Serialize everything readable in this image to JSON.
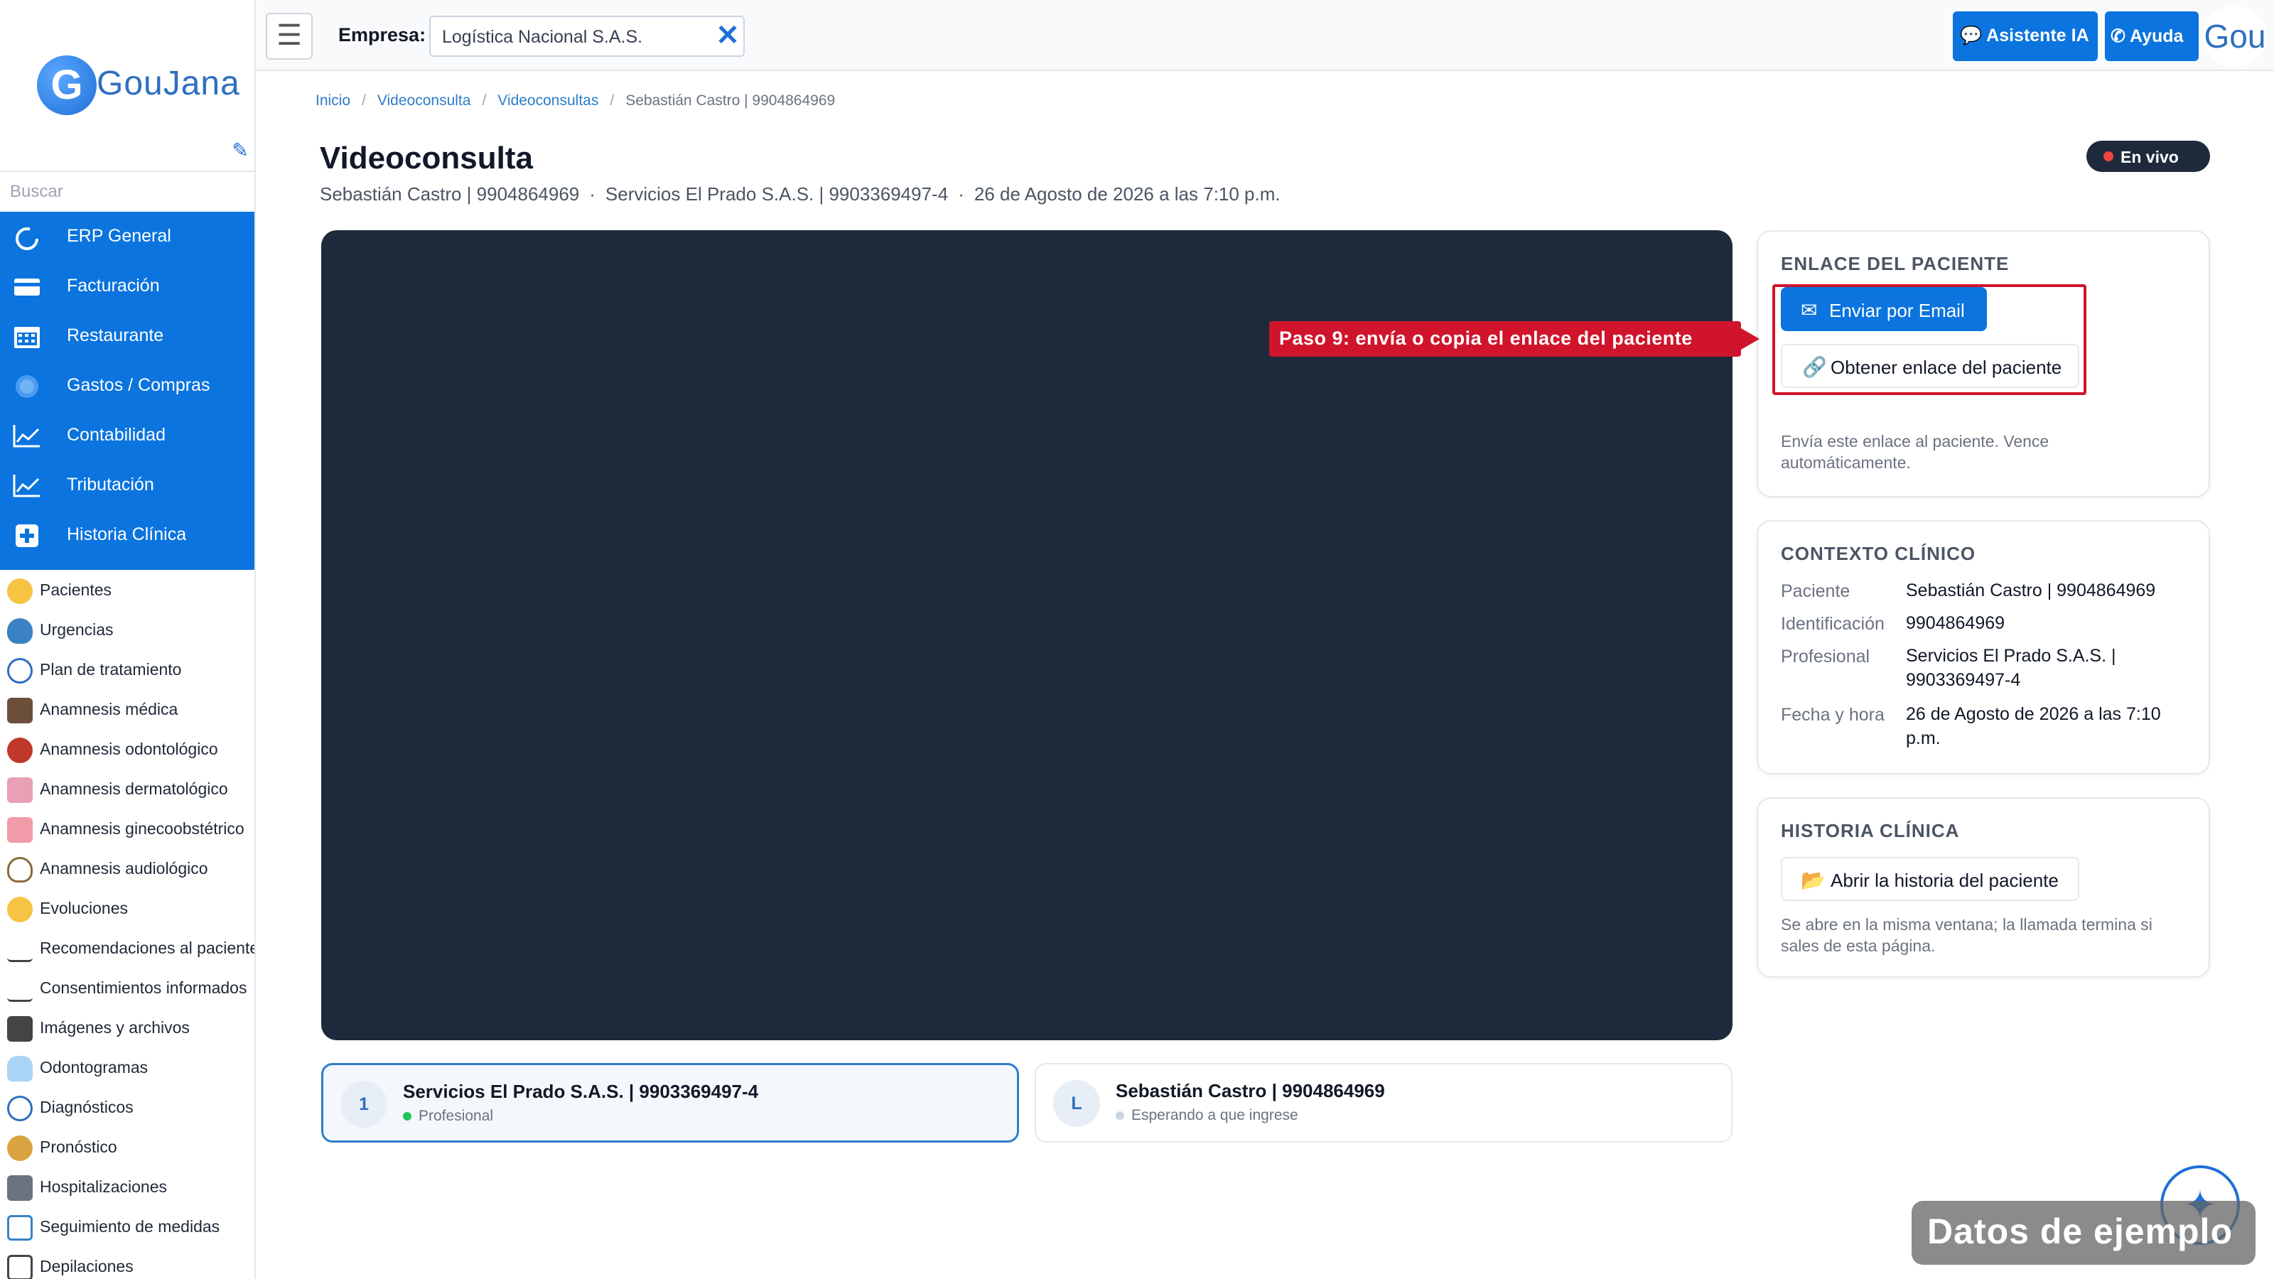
{
  "brand": {
    "logo_letter": "G",
    "name": "GouJana"
  },
  "sidebar": {
    "search_placeholder": "Buscar",
    "modules": [
      {
        "label": "ERP General",
        "icon": "circle-refresh-icon"
      },
      {
        "label": "Facturación",
        "icon": "credit-card-icon"
      },
      {
        "label": "Restaurante",
        "icon": "calendar-icon"
      },
      {
        "label": "Gastos / Compras",
        "icon": "blur-circle-icon"
      },
      {
        "label": "Contabilidad",
        "icon": "line-chart-icon"
      },
      {
        "label": "Tributación",
        "icon": "line-chart-icon"
      },
      {
        "label": "Historia Clínica",
        "icon": "plus-square-icon"
      }
    ],
    "subitems": [
      {
        "label": "Pacientes",
        "icon": "smiley-face-icon"
      },
      {
        "label": "Urgencias",
        "icon": "shield-icon"
      },
      {
        "label": "Plan de tratamiento",
        "icon": "compass-icon"
      },
      {
        "label": "Anamnesis médica",
        "icon": "doctor-icon"
      },
      {
        "label": "Anamnesis odontológico",
        "icon": "mouth-icon"
      },
      {
        "label": "Anamnesis dermatológico",
        "icon": "skin-icon"
      },
      {
        "label": "Anamnesis ginecoobstétrico",
        "icon": "uterus-icon"
      },
      {
        "label": "Anamnesis audiológico",
        "icon": "ear-icon"
      },
      {
        "label": "Evoluciones",
        "icon": "thinking-face-icon"
      },
      {
        "label": "Recomendaciones al paciente",
        "icon": "signature-icon"
      },
      {
        "label": "Consentimientos informados",
        "icon": "signature-icon"
      },
      {
        "label": "Imágenes y archivos",
        "icon": "camera-icon"
      },
      {
        "label": "Odontogramas",
        "icon": "tooth-icon"
      },
      {
        "label": "Diagnósticos",
        "icon": "stethoscope-icon"
      },
      {
        "label": "Pronóstico",
        "icon": "face-icon"
      },
      {
        "label": "Hospitalizaciones",
        "icon": "bed-icon"
      },
      {
        "label": "Seguimiento de medidas",
        "icon": "scale-icon"
      },
      {
        "label": "Depilaciones",
        "icon": "razor-icon"
      }
    ]
  },
  "topbar": {
    "menu_icon": "☰",
    "empresa_label": "Empresa:",
    "empresa_value": "Logística Nacional S.A.S.",
    "clear_icon": "✕",
    "asistente_label": "Asistente IA",
    "ayuda_label": "Ayuda",
    "user_label": "Gou"
  },
  "breadcrumb": {
    "items": [
      "Inicio",
      "Videoconsulta",
      "Videoconsultas"
    ],
    "current": "Sebastián Castro | 9904864969",
    "separator": "/"
  },
  "header": {
    "title": "Videoconsulta",
    "patient": "Sebastián Castro | 9904864969",
    "professional": "Servicios El Prado S.A.S. | 9903369497-4",
    "datetime": "26 de Agosto de 2026 a las 7:10 p.m.",
    "dot": "·",
    "live_label": "En vivo"
  },
  "participants": [
    {
      "initial": "1",
      "name": "Servicios El Prado S.A.S. | 9903369497-4",
      "status": "Profesional",
      "status_color": "#22c55e"
    },
    {
      "initial": "L",
      "name": "Sebastián Castro | 9904864969",
      "status": "Esperando a que ingrese",
      "status_color": "#cbd5e1"
    }
  ],
  "enlace_panel": {
    "title": "ENLACE DEL PACIENTE",
    "email_button": "Enviar por Email",
    "link_button": "Obtener enlace del paciente",
    "note": "Envía este enlace al paciente. Vence automáticamente."
  },
  "contexto_panel": {
    "title": "CONTEXTO CLÍNICO",
    "rows": [
      {
        "key": "Paciente",
        "value": "Sebastián Castro | 9904864969"
      },
      {
        "key": "Identificación",
        "value": "9904864969"
      },
      {
        "key": "Profesional",
        "value": "Servicios El Prado S.A.S. | 9903369497-4"
      },
      {
        "key": "Fecha y hora",
        "value": "26 de Agosto de 2026 a las 7:10 p.m."
      }
    ]
  },
  "historia_panel": {
    "title": "HISTORIA CLÍNICA",
    "button": "Abrir la historia del paciente",
    "note": "Se abre en la misma ventana; la llamada termina si sales de esta página."
  },
  "annotation": {
    "text": "Paso 9: envía o copia el enlace del paciente",
    "color": "#d0142c"
  },
  "overlay": {
    "sample_badge": "Datos de ejemplo",
    "fab_icon": "sparkle-icon"
  },
  "colors": {
    "primary": "#0b74de",
    "video_bg": "#1e2a3b",
    "link": "#2e7dc9"
  }
}
